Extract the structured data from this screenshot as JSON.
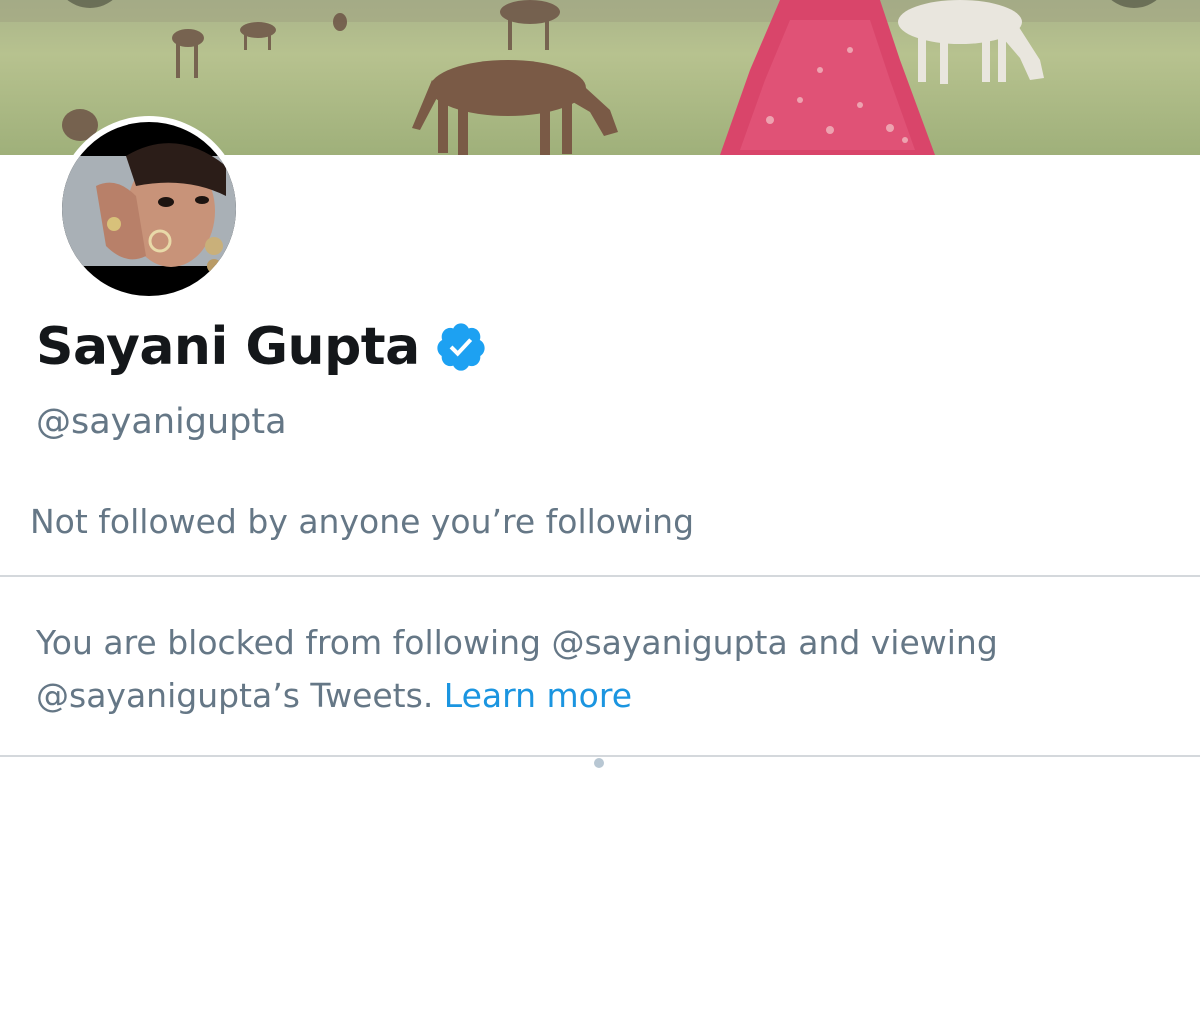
{
  "profile": {
    "display_name": "Sayani Gupta",
    "handle": "@sayanigupta",
    "verified": true,
    "followers_you_know": "Not followed by anyone you’re following"
  },
  "blocked_notice": {
    "line1": "You are blocked from following @sayanigupta and viewing",
    "line2_text": "@sayanigupta’s Tweets. ",
    "learn_more_label": "Learn more"
  },
  "icons": {
    "verified": "verified-badge-icon",
    "loading": "loading-dot"
  },
  "colors": {
    "name_text": "#14171a",
    "secondary_text": "#657786",
    "link": "#1b95e0",
    "verified_badge": "#1da1f2",
    "divider": "#d4d8dc"
  }
}
